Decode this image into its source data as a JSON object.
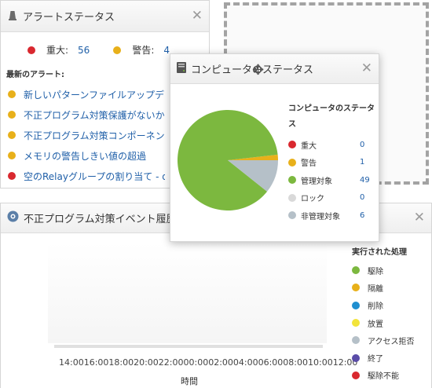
{
  "alert_panel": {
    "title": "アラートステータス",
    "counts": [
      {
        "label": "重大:",
        "value": "56",
        "color": "#d9282f"
      },
      {
        "label": "警告:",
        "value": "4",
        "color": "#e8b01a"
      }
    ],
    "recent_title": "最新のアラート:",
    "alerts": [
      {
        "text": "新しいパターンファイルアップデー…",
        "color": "#e8b01a"
      },
      {
        "text": "不正プログラム対策保護がないか…",
        "color": "#e8b01a"
      },
      {
        "text": "不正プログラム対策コンポーネン…",
        "color": "#e8b01a"
      },
      {
        "text": "メモリの警告しきい値の超過",
        "color": "#e8b01a"
      },
      {
        "text": "空のRelayグループの割り当て - d…",
        "color": "#d9282f"
      }
    ]
  },
  "computer_panel": {
    "title": "コンピュータのステータス",
    "legend_title": "コンピュータのステータス",
    "items": [
      {
        "label": "重大",
        "value": 0,
        "color": "#d9282f"
      },
      {
        "label": "警告",
        "value": 1,
        "color": "#e8b01a"
      },
      {
        "label": "管理対象",
        "value": 49,
        "color": "#7cb83f"
      },
      {
        "label": "ロック",
        "value": 0,
        "color": "#d9d9d9"
      },
      {
        "label": "非管理対象",
        "value": 6,
        "color": "#b5c0c8"
      }
    ]
  },
  "event_panel": {
    "title": "不正プログラム対策イベント履歴",
    "x_ticks": "14:0016:0018:0020:0022:0000:0002:0004:0006:0008:0010:0012:00",
    "x_label": "時間",
    "legend_title": "実行された処理",
    "legend": [
      {
        "label": "駆除",
        "color": "#7cb83f"
      },
      {
        "label": "隔離",
        "color": "#e8b01a"
      },
      {
        "label": "削除",
        "color": "#1f8fd0"
      },
      {
        "label": "放置",
        "color": "#f2e43a"
      },
      {
        "label": "アクセス拒否",
        "color": "#b5c0c8"
      },
      {
        "label": "終了",
        "color": "#5a4ca8"
      },
      {
        "label": "駆除不能",
        "color": "#d9282f"
      }
    ]
  },
  "chart_data": {
    "type": "pie",
    "title": "",
    "categories": [
      "重大",
      "警告",
      "管理対象",
      "ロック",
      "非管理対象"
    ],
    "values": [
      0,
      1,
      49,
      0,
      6
    ],
    "colors": [
      "#d9282f",
      "#e8b01a",
      "#7cb83f",
      "#d9d9d9",
      "#b5c0c8"
    ]
  }
}
